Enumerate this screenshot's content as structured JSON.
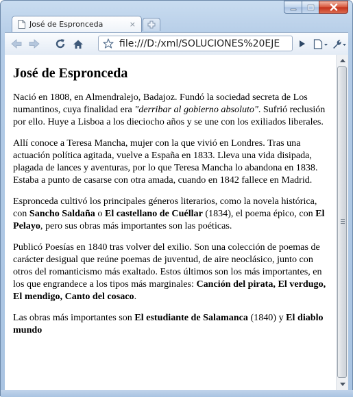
{
  "window": {
    "tab_title": "José de Espronceda",
    "tab_close": "×",
    "url": "file:///D:/xml/SOLUCIONES%20EJE"
  },
  "colors": {
    "frame": "#b3cbe6",
    "close_button": "#c2301a",
    "nav_arrow": "#a9bfd8",
    "text": "#000000"
  },
  "icons": [
    "page-icon",
    "new-tab-icon",
    "back-icon",
    "forward-icon",
    "reload-icon",
    "home-icon",
    "bookmark-star-icon",
    "go-icon",
    "page-menu-icon",
    "wrench-icon",
    "minimize-icon",
    "maximize-icon",
    "close-icon"
  ],
  "content": {
    "title": "José de Espronceda",
    "p1": {
      "a": "Nació en 1808, en Almendralejo, Badajoz. Fundó la sociedad secreta de Los numantinos, cuya finalidad era ",
      "quote": "\"derribar al gobierno absoluto\"",
      "b": ". Sufrió reclusión por ello. Huye a Lisboa a los dieciocho años y se une con los exiliados liberales."
    },
    "p2": "Allí conoce a Teresa Mancha, mujer con la que vivió en Londres. Tras una actuación política agitada, vuelve a España en 1833. Lleva una vida disipada, plagada de lances y aventuras, por lo que Teresa Mancha lo abandona en 1838. Estaba a punto de casarse con otra amada, cuando en 1842 fallece en Madrid.",
    "p3": {
      "a": "Espronceda cultivó los principales géneros literarios, como la novela histórica, con ",
      "b1": "Sancho Saldaña",
      "c": " o ",
      "b2": "El castellano de Cuéllar",
      "d": " (1834), el poema épico, con ",
      "b3": "El Pelayo",
      "e": ", pero sus obras más importantes son las poéticas."
    },
    "p4": {
      "a": "Publicó Poesías en 1840 tras volver del exilio. Son una colección de poemas de carácter desigual que reúne poemas de juventud, de aire neoclásico, junto con otros del romanticismo más exaltado. Estos últimos son los más importantes, en los que engrandece a los tipos más marginales: ",
      "b": "Canción del pirata, El verdugo, El mendigo, Canto del cosaco",
      "c": "."
    },
    "p5": {
      "a": "Las obras más importantes son ",
      "b1": "El estudiante de Salamanca",
      "c": " (1840) y ",
      "b2": "El diablo mundo"
    }
  }
}
